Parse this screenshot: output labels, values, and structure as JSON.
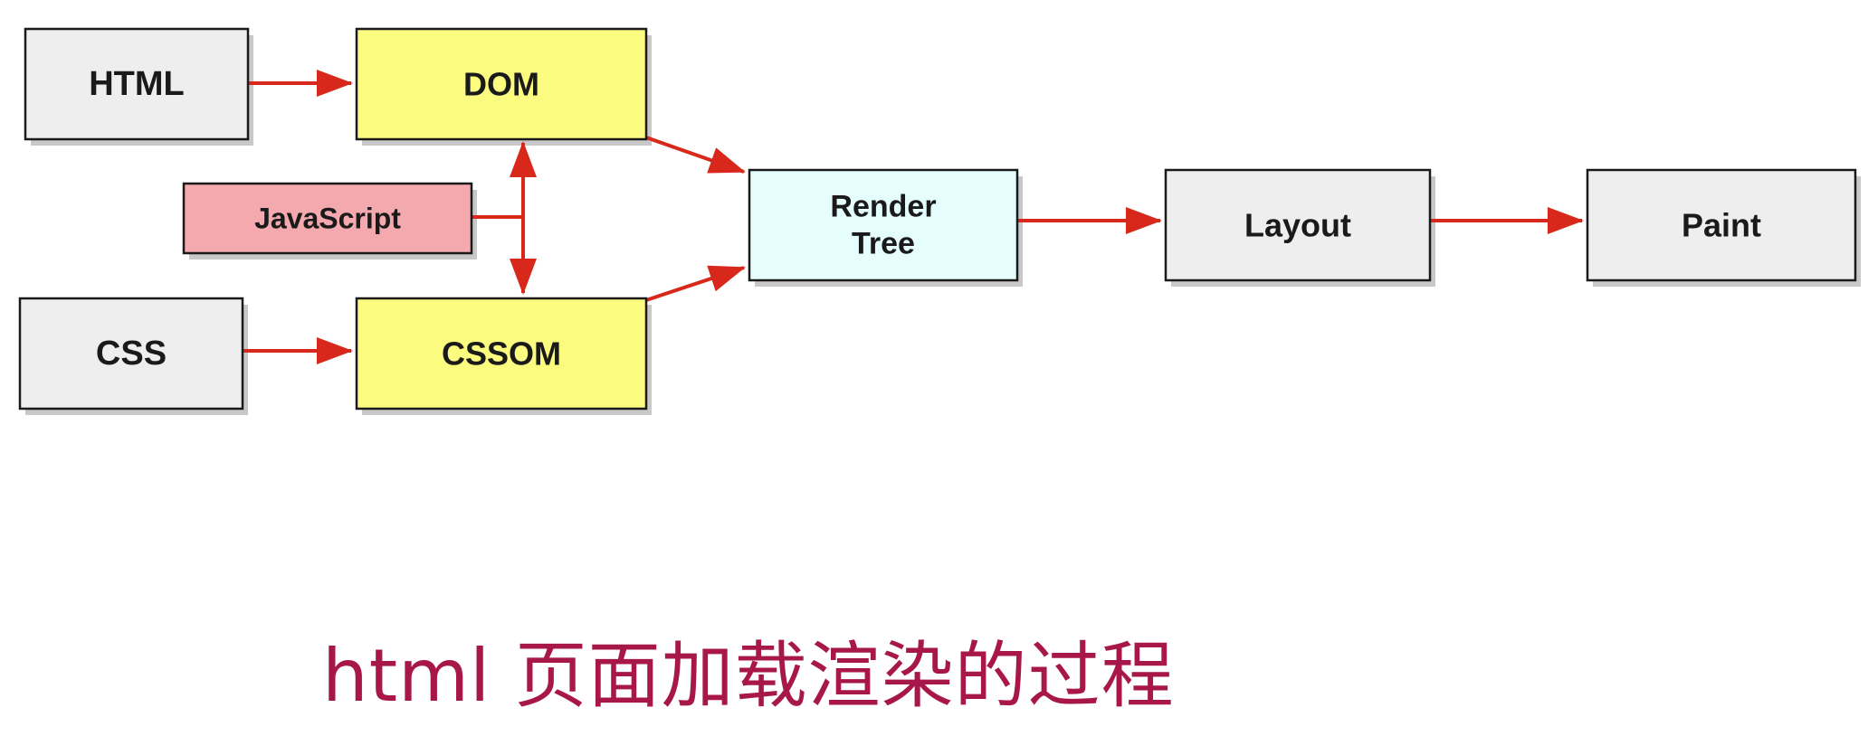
{
  "diagram": {
    "nodes": {
      "html": {
        "label_lines": [
          "HTML"
        ]
      },
      "dom": {
        "label_lines": [
          "DOM"
        ]
      },
      "javascript": {
        "label_lines": [
          "JavaScript"
        ]
      },
      "css": {
        "label_lines": [
          "CSS"
        ]
      },
      "cssom": {
        "label_lines": [
          "CSSOM"
        ]
      },
      "render_tree": {
        "label_lines": [
          "Render",
          "Tree"
        ]
      },
      "layout": {
        "label_lines": [
          "Layout"
        ]
      },
      "paint": {
        "label_lines": [
          "Paint"
        ]
      }
    },
    "colors": {
      "gray_fill": "#eeeeee",
      "yellow_fill": "#fbfb7f",
      "pink_fill": "#f4a9ae",
      "cyan_fill": "#e6fdfe",
      "arrow": "#d8281c",
      "border": "#1a1a1a",
      "shadow": "#9a9a9a"
    }
  },
  "caption": {
    "text": "html 页面加载渲染的过程",
    "color": "#a8174a"
  }
}
